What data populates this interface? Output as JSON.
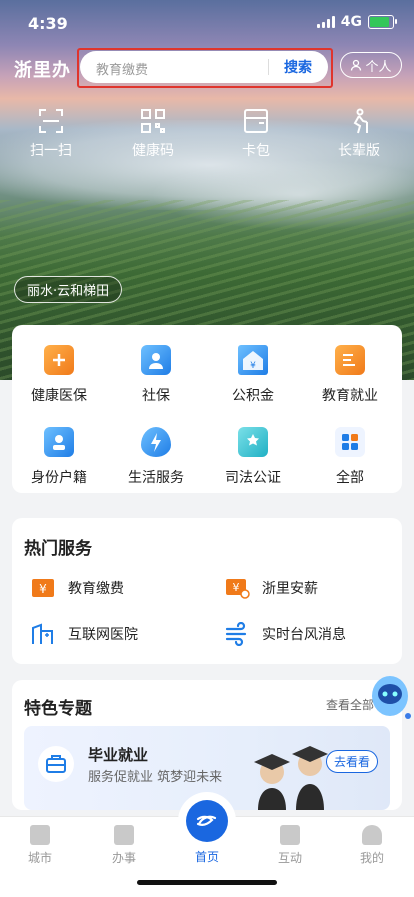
{
  "status": {
    "time": "4:39",
    "network": "4G"
  },
  "header": {
    "logo": "浙里办",
    "search_placeholder": "教育缴费",
    "search_button": "搜索",
    "profile_label": "个人"
  },
  "quick_actions": [
    {
      "label": "扫一扫",
      "icon": "scan-icon"
    },
    {
      "label": "健康码",
      "icon": "qr-code-icon"
    },
    {
      "label": "卡包",
      "icon": "card-wallet-icon"
    },
    {
      "label": "长辈版",
      "icon": "elder-icon"
    }
  ],
  "location_tag": "丽水·云和梯田",
  "services": [
    {
      "label": "健康医保",
      "icon": "medical-insurance-icon",
      "color": "#f08a24"
    },
    {
      "label": "社保",
      "icon": "social-security-icon",
      "color": "#2a8ef0"
    },
    {
      "label": "公积金",
      "icon": "housing-fund-icon",
      "color": "#2a8ef0"
    },
    {
      "label": "教育就业",
      "icon": "education-icon",
      "color": "#f08a24"
    },
    {
      "label": "身份户籍",
      "icon": "id-card-icon",
      "color": "#2a8ef0"
    },
    {
      "label": "生活服务",
      "icon": "life-service-icon",
      "color": "#2a8ef0"
    },
    {
      "label": "司法公证",
      "icon": "notary-icon",
      "color": "#29b6c7"
    },
    {
      "label": "全部",
      "icon": "all-apps-icon",
      "color": "#2a8ef0"
    }
  ],
  "hot": {
    "title": "热门服务",
    "items": [
      {
        "label": "教育缴费",
        "icon": "tuition-payment-icon"
      },
      {
        "label": "浙里安薪",
        "icon": "salary-icon"
      },
      {
        "label": "互联网医院",
        "icon": "hospital-icon"
      },
      {
        "label": "实时台风消息",
        "icon": "typhoon-icon"
      }
    ]
  },
  "special": {
    "title": "特色专题",
    "more": "查看全部",
    "banner_title": "毕业就业",
    "banner_sub": "服务促就业 筑梦迎未来",
    "banner_button": "去看看"
  },
  "tabs": [
    {
      "label": "城市"
    },
    {
      "label": "办事"
    },
    {
      "label": "首页"
    },
    {
      "label": "互动"
    },
    {
      "label": "我的"
    }
  ]
}
